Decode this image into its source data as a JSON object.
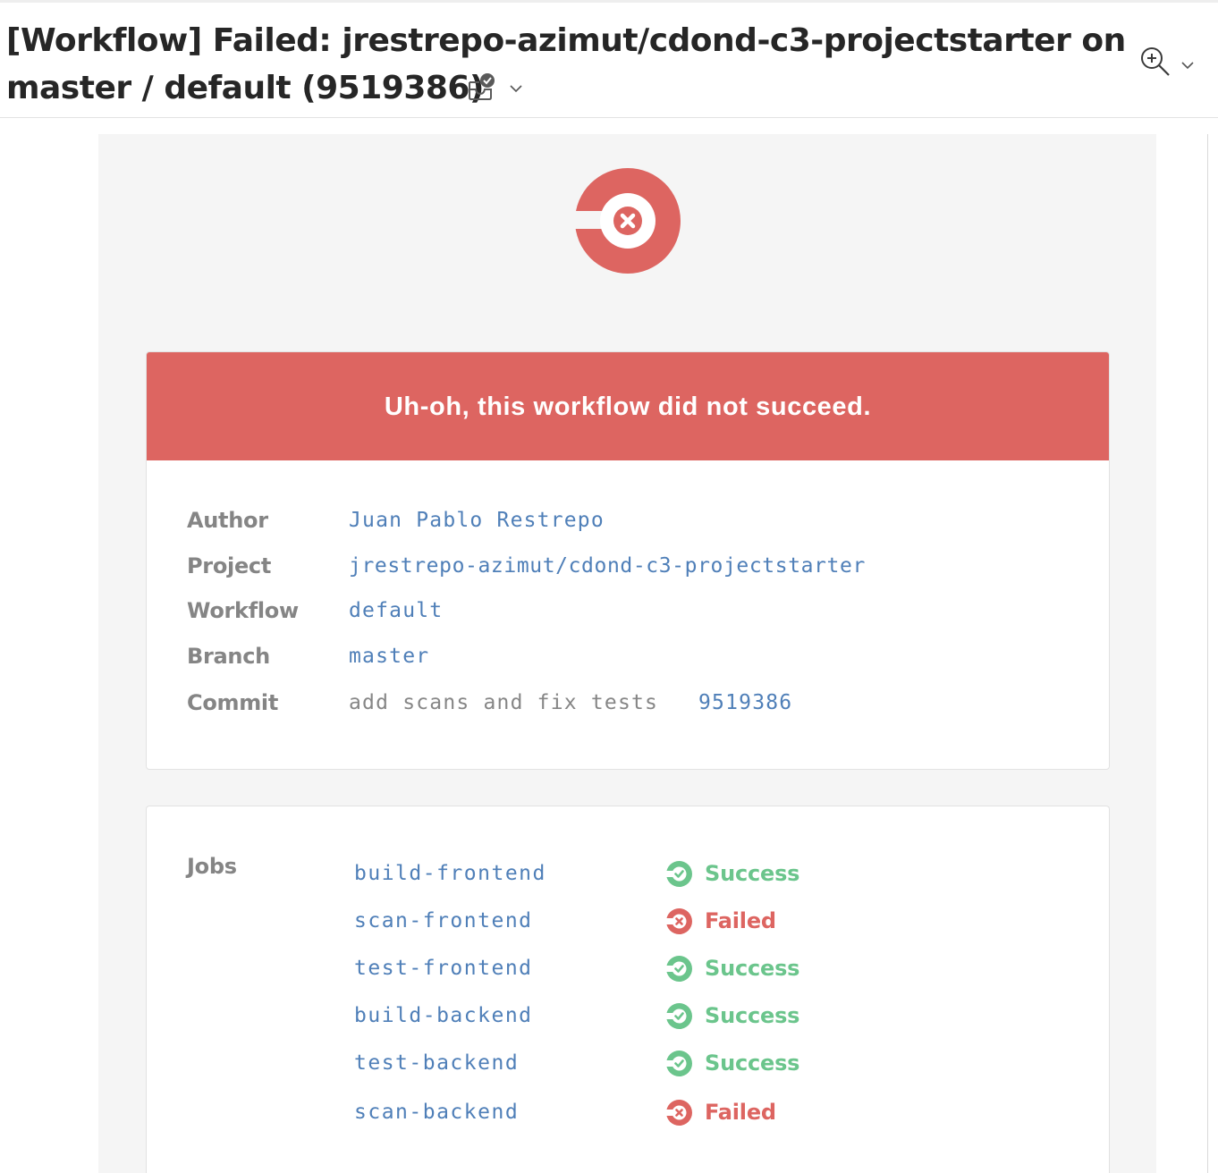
{
  "email": {
    "subject_line1": "[Workflow] Failed: jrestrepo-azimut/cdond-c3-projectstarter on",
    "subject_line2": "master / default (9519386)",
    "icons": {
      "inbox": "inbox-check-icon",
      "zoom": "zoom-in-icon",
      "dropdown": "chevron-down-icon"
    }
  },
  "notification": {
    "logo_icon": "circleci-failed-logo-icon",
    "banner": "Uh-oh, this workflow did not succeed.",
    "colors": {
      "failed": "#dd6561",
      "success": "#6bc58c",
      "link": "#4f7fb8",
      "label": "#858585",
      "background": "#f5f5f5"
    },
    "details": [
      {
        "label": "Author",
        "value": "Juan Pablo Restrepo",
        "link": true
      },
      {
        "label": "Project",
        "value": "jrestrepo-azimut/cdond-c3-projectstarter",
        "link": true
      },
      {
        "label": "Workflow",
        "value": "default",
        "link": true
      },
      {
        "label": "Branch",
        "value": "master",
        "link": true
      },
      {
        "label": "Commit",
        "value": "add scans and fix tests",
        "hash": "9519386",
        "link": false
      }
    ],
    "jobs_label": "Jobs",
    "jobs": [
      {
        "name": "build-frontend",
        "status": "Success",
        "state": "success"
      },
      {
        "name": "scan-frontend",
        "status": "Failed",
        "state": "failed"
      },
      {
        "name": "test-frontend",
        "status": "Success",
        "state": "success"
      },
      {
        "name": "build-backend",
        "status": "Success",
        "state": "success"
      },
      {
        "name": "test-backend",
        "status": "Success",
        "state": "success"
      },
      {
        "name": "scan-backend",
        "status": "Failed",
        "state": "failed"
      }
    ]
  }
}
